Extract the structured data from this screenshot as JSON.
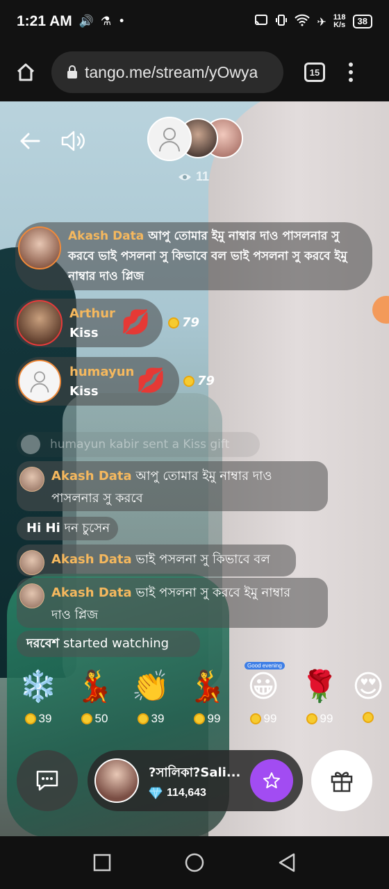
{
  "status_bar": {
    "time": "1:21 AM",
    "net_speed_value": "118",
    "net_speed_unit": "K/s",
    "battery": "38"
  },
  "browser": {
    "url": "tango.me/stream/yOwya",
    "tab_count": "15"
  },
  "stream": {
    "viewer_count": "11"
  },
  "chat": {
    "highlighted": [
      {
        "name": "Akash Data",
        "message": "আপু তোমার ইমু নাম্বার দাও পাসলনার সু করবে ভাই পসলনা সু কিভাবে বল ভাই পসলনা সু করবে ইমু নাম্বার দাও প্লিজ"
      },
      {
        "name": "Arthur",
        "message": "Kiss",
        "coins": "79"
      },
      {
        "name": "humayun",
        "message": "Kiss",
        "coins": "79"
      }
    ],
    "faded_message": "humayun kabir  sent a Kiss gift",
    "messages": [
      {
        "name": "Akash Data",
        "line1": "আপু তোমার ইমু নাম্বার দাও",
        "line2": "পাসলনার সু করবে"
      },
      {
        "name": "Hi Hi",
        "text": "দন চুসেন"
      },
      {
        "name": "Akash Data",
        "line1": "ভাই পসলনা সু কিভাবে বল"
      },
      {
        "name": "Akash Data",
        "line1": "ভাই পসলনা সু করবে ইমু নাম্বার",
        "line2": "দাও প্লিজ"
      },
      {
        "name": "দরবেশ",
        "text": "started watching"
      }
    ]
  },
  "gifts": [
    {
      "icon": "snowflake-icon",
      "glyph": "❄️",
      "price": "39"
    },
    {
      "icon": "dancers-icon",
      "glyph": "💃",
      "price": "50"
    },
    {
      "icon": "clapping-icon",
      "glyph": "👏",
      "price": "39"
    },
    {
      "icon": "dancer-icon",
      "glyph": "💃",
      "price": "99"
    },
    {
      "icon": "good-evening-emoji-icon",
      "glyph": "😀",
      "price": "99",
      "badge": "Good evening"
    },
    {
      "icon": "rose-icon",
      "glyph": "🌹",
      "price": "99"
    },
    {
      "icon": "heart-eyes-emoji-icon",
      "glyph": "😍",
      "price": ""
    }
  ],
  "host": {
    "name": "?সালিকা?Sali...",
    "diamonds": "114,643"
  },
  "colors": {
    "accent_purple": "#a24cf2",
    "name_orange": "#f5b85e",
    "coin_yellow": "#f6cb2f",
    "diamond_blue": "#6ad0f7"
  }
}
